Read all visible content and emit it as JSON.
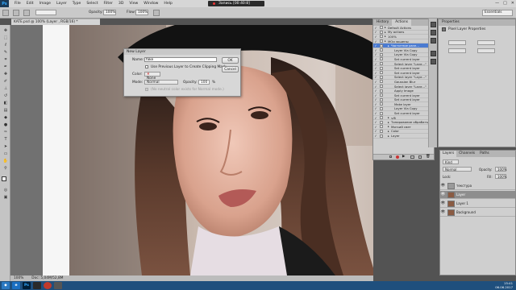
{
  "app": {
    "logo": "Ps",
    "menu": [
      "File",
      "Edit",
      "Image",
      "Layer",
      "Type",
      "Select",
      "Filter",
      "3D",
      "View",
      "Window",
      "Help"
    ],
    "recording": "Запись [00:40:8]",
    "window_controls": [
      "—",
      "□",
      "✕"
    ]
  },
  "options_bar": {
    "opacity_label": "Opacity:",
    "opacity_value": "100%",
    "flow_label": "Flow:",
    "flow_value": "100%",
    "workspace": "Essentials"
  },
  "document": {
    "tab_title": "KATE.psd @ 100% (Layer , RGB/16) *",
    "zoom": "100%",
    "doc_info": "Doc: 5,04M/52,8M"
  },
  "dialog": {
    "title": "New Layer",
    "name_label": "Name:",
    "name_value": "fake",
    "clipping_label": "Use Previous Layer to Create Clipping Mask",
    "color_label": "Color:",
    "color_value": "None",
    "mode_label": "Mode:",
    "mode_value": "Normal",
    "opacity_label": "Opacity:",
    "opacity_value": "100",
    "opacity_unit": "%",
    "neutral_note": "(No neutral color exists for Normal mode.)",
    "ok_label": "OK",
    "cancel_label": "Cancel"
  },
  "actions_panel": {
    "tabs": [
      "History",
      "Actions"
    ],
    "active_tab": "Actions",
    "rows": [
      {
        "label": "Default Actions",
        "level": 0,
        "type": "set",
        "selected": false
      },
      {
        "label": "My actions",
        "level": 0,
        "type": "set",
        "selected": false
      },
      {
        "label": "100%",
        "level": 0,
        "type": "set",
        "selected": false
      },
      {
        "label": "МОи экшены",
        "level": 0,
        "type": "set",
        "selected": false
      },
      {
        "label": "Частотное разл...",
        "level": 1,
        "type": "action",
        "selected": true
      },
      {
        "label": "Layer Via Copy",
        "level": 2,
        "type": "step",
        "selected": false
      },
      {
        "label": "Layer Via Copy",
        "level": 2,
        "type": "step",
        "selected": false
      },
      {
        "label": "Set current layer",
        "level": 2,
        "type": "step",
        "selected": false
      },
      {
        "label": "Select layer \"Laye...\"",
        "level": 2,
        "type": "step",
        "selected": false
      },
      {
        "label": "Set current layer",
        "level": 2,
        "type": "step",
        "selected": false
      },
      {
        "label": "Set current layer",
        "level": 2,
        "type": "step",
        "selected": false
      },
      {
        "label": "Select layer \"Laye...\"",
        "level": 2,
        "type": "step",
        "selected": false
      },
      {
        "label": "Gaussian Blur",
        "level": 2,
        "type": "step",
        "selected": false
      },
      {
        "label": "Select layer \"Laye...\"",
        "level": 2,
        "type": "step",
        "selected": false
      },
      {
        "label": "Apply Image",
        "level": 2,
        "type": "step",
        "selected": false
      },
      {
        "label": "Set current layer",
        "level": 2,
        "type": "step",
        "selected": false
      },
      {
        "label": "Set current layer",
        "level": 2,
        "type": "step",
        "selected": false
      },
      {
        "label": "Make layer",
        "level": 2,
        "type": "step",
        "selected": false
      },
      {
        "label": "Layer Via Copy",
        "level": 2,
        "type": "step",
        "selected": false
      },
      {
        "label": "Set current layer",
        "level": 2,
        "type": "step",
        "selected": false
      },
      {
        "label": "ч/б",
        "level": 1,
        "type": "action",
        "selected": false
      },
      {
        "label": "Тонирование обрабатыв...",
        "level": 1,
        "type": "action",
        "selected": false
      },
      {
        "label": "Мягкий свет",
        "level": 1,
        "type": "action",
        "selected": false
      },
      {
        "label": "Color",
        "level": 1,
        "type": "action",
        "selected": false
      },
      {
        "label": "Layer",
        "level": 1,
        "type": "action",
        "selected": false
      }
    ]
  },
  "properties_panel": {
    "tab": "Properties",
    "header": "Pixel Layer Properties"
  },
  "layers_panel": {
    "tabs": [
      "Layers",
      "Channels",
      "Paths"
    ],
    "active_tab": "Layers",
    "kind_label": "Kind",
    "blend_mode": "Normal",
    "opacity_label": "Opacity:",
    "opacity_value": "100%",
    "lock_label": "Lock:",
    "fill_label": "Fill:",
    "fill_value": "100%",
    "layers": [
      {
        "name": "текстура",
        "selected": false
      },
      {
        "name": "Layer",
        "selected": true
      },
      {
        "name": "Layer 1",
        "selected": false
      },
      {
        "name": "Background",
        "selected": false
      }
    ]
  },
  "taskbar": {
    "items": [
      "e",
      "Ps",
      "",
      "",
      ""
    ],
    "time": "15:41",
    "date": "06.06.2017"
  }
}
